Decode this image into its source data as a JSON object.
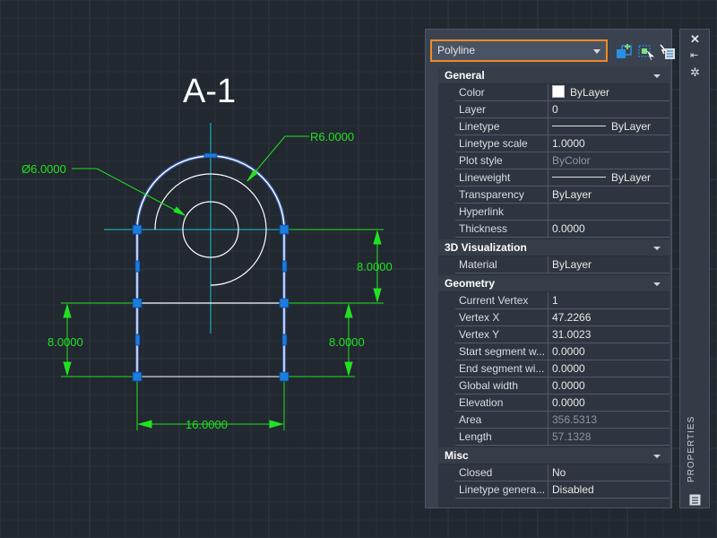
{
  "colors": {
    "background": "#212830",
    "gridMinor": "#29303a",
    "gridMajor": "#2f3744",
    "geometry": "#ffffff",
    "centerline": "#1fc4cf",
    "dimension": "#22e022",
    "grip": "#1b7cde",
    "selectionHalo": "#4a7dff",
    "accent": "#f08a24"
  },
  "drawing": {
    "title": "A-1",
    "dims": {
      "radius": "R6.0000",
      "diameter": "Ø6.0000",
      "right_upper": "8.0000",
      "left_lower": "8.0000",
      "right_lower": "8.0000",
      "bottom": "16.0000"
    }
  },
  "palette": {
    "object_type": "Polyline",
    "toolbar_icons": [
      "quick-select-icon",
      "select-objects-icon",
      "toggle-pickadd-icon"
    ],
    "side_label": "PROPERTIES",
    "sections": [
      {
        "title": "General",
        "rows": [
          {
            "name": "Color",
            "value": "ByLayer"
          },
          {
            "name": "Layer",
            "value": "0"
          },
          {
            "name": "Linetype",
            "value": "ByLayer"
          },
          {
            "name": "Linetype scale",
            "value": "1.0000"
          },
          {
            "name": "Plot style",
            "value": "ByColor"
          },
          {
            "name": "Lineweight",
            "value": "ByLayer"
          },
          {
            "name": "Transparency",
            "value": "ByLayer"
          },
          {
            "name": "Hyperlink",
            "value": ""
          },
          {
            "name": "Thickness",
            "value": "0.0000"
          }
        ]
      },
      {
        "title": "3D Visualization",
        "rows": [
          {
            "name": "Material",
            "value": "ByLayer"
          }
        ]
      },
      {
        "title": "Geometry",
        "rows": [
          {
            "name": "Current Vertex",
            "value": "1"
          },
          {
            "name": "Vertex X",
            "value": "47.2266"
          },
          {
            "name": "Vertex Y",
            "value": "31.0023"
          },
          {
            "name": "Start segment w...",
            "value": "0.0000"
          },
          {
            "name": "End segment wi...",
            "value": "0.0000"
          },
          {
            "name": "Global width",
            "value": "0.0000"
          },
          {
            "name": "Elevation",
            "value": "0.0000"
          },
          {
            "name": "Area",
            "value": "356.5313"
          },
          {
            "name": "Length",
            "value": "57.1328"
          }
        ]
      },
      {
        "title": "Misc",
        "rows": [
          {
            "name": "Closed",
            "value": "No"
          },
          {
            "name": "Linetype genera...",
            "value": "Disabled"
          }
        ]
      }
    ]
  }
}
